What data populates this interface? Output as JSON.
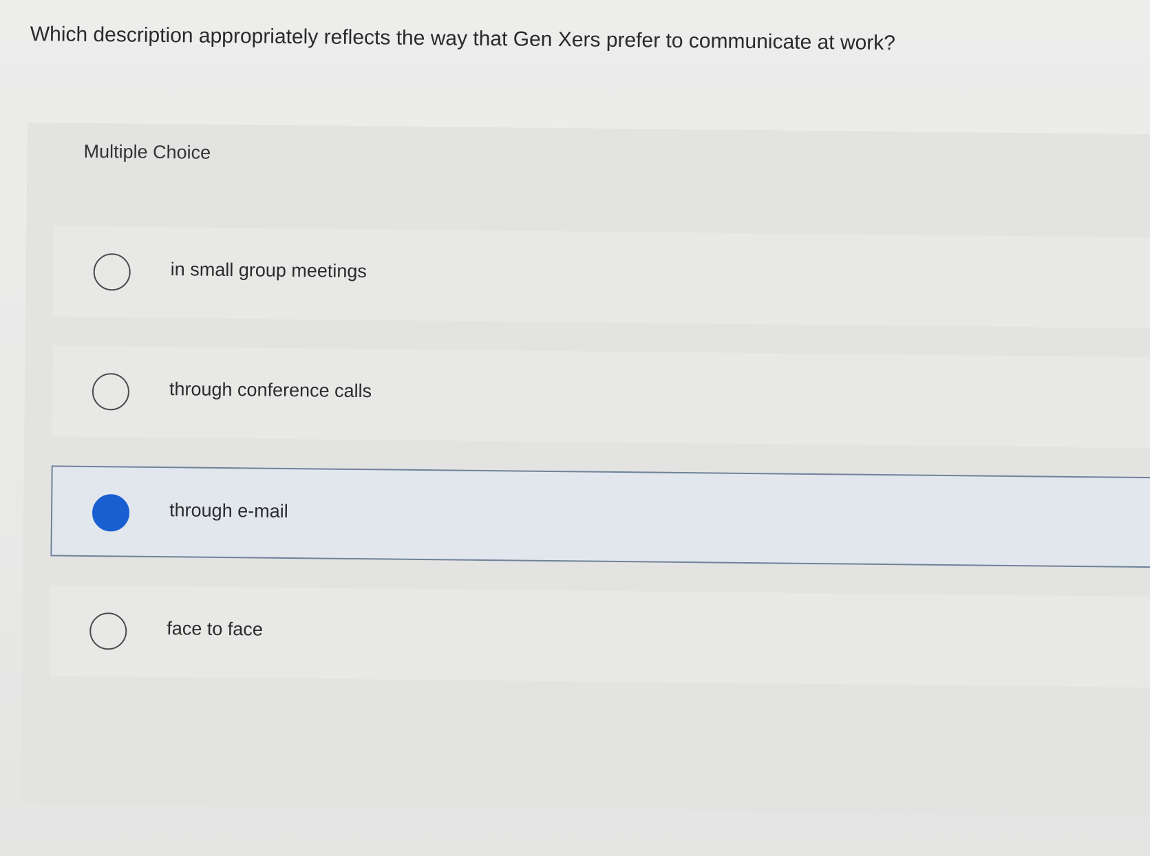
{
  "question": {
    "text": "Which description appropriately reflects the way that Gen Xers prefer to communicate at work?"
  },
  "question_type": {
    "label": "Multiple Choice"
  },
  "options": [
    {
      "label": "in small group meetings",
      "selected": false
    },
    {
      "label": "through conference calls",
      "selected": false
    },
    {
      "label": "through e-mail",
      "selected": true
    },
    {
      "label": "face to face",
      "selected": false
    }
  ],
  "colors": {
    "selected_radio": "#1a5fd1",
    "selected_border": "#6f8299",
    "selected_background": "#e2e7ee"
  }
}
